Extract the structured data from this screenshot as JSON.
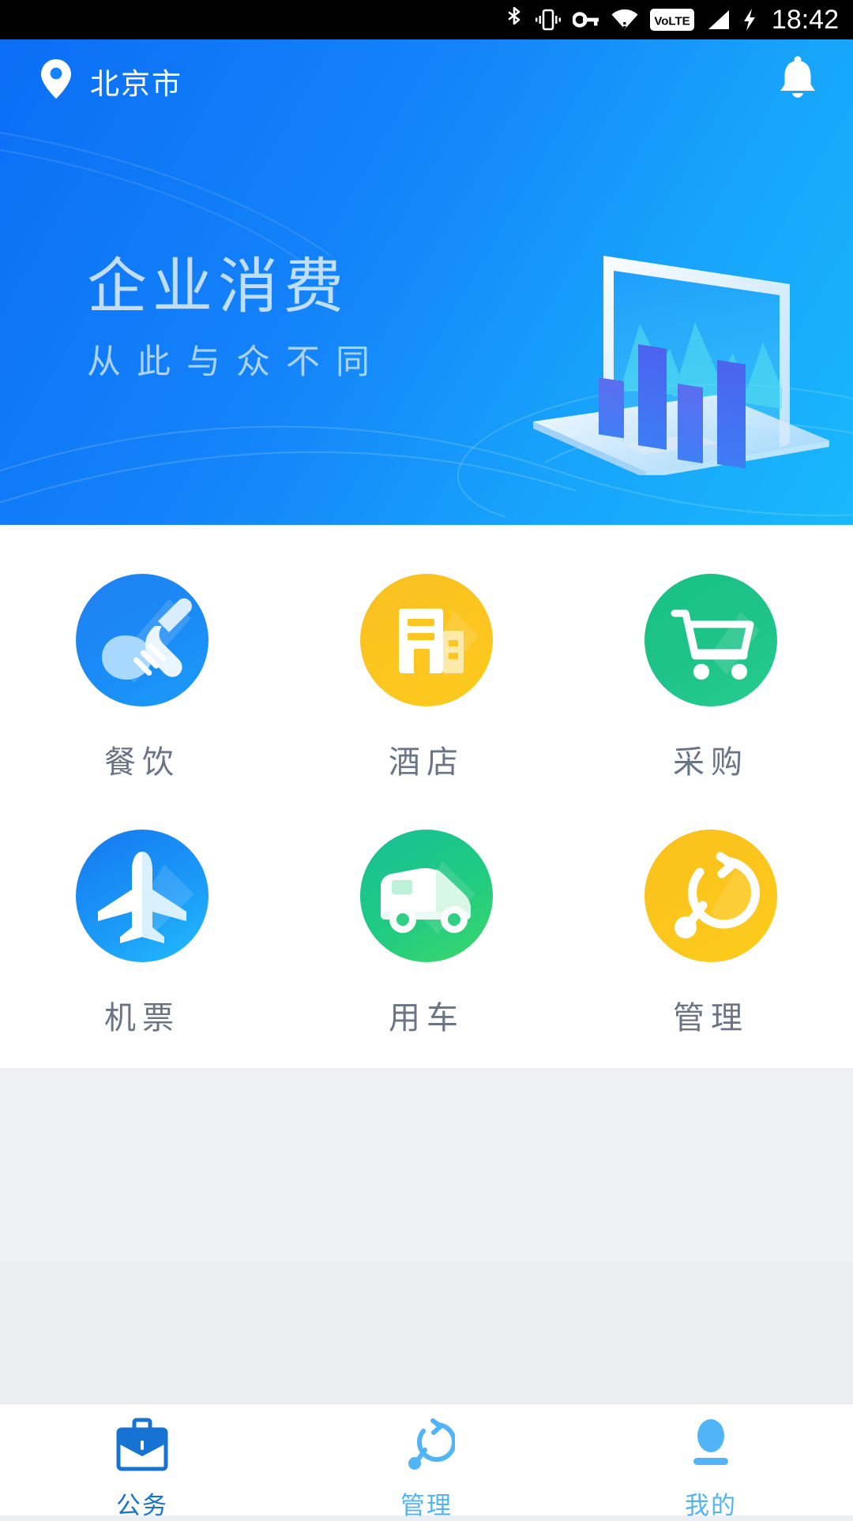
{
  "statusbar": {
    "time": "18:42",
    "icons": [
      "bluetooth-icon",
      "vibrate-icon",
      "vpn-key-icon",
      "wifi-icon",
      "volte-icon",
      "signal-icon",
      "charging-bolt-icon"
    ],
    "volte_label": "VoLTE",
    "background": "#000000"
  },
  "header": {
    "location_icon": "location-pin-icon",
    "location": "北京市",
    "notification_icon": "bell-icon"
  },
  "banner": {
    "title": "企业消费",
    "subtitle": "从此与众不同",
    "illustration": "laptop-bar-chart-illustration",
    "gradient_start": "#0b6ef5",
    "gradient_end": "#19b8fc",
    "title_color": "#cfe6ff",
    "subtitle_color": "#bcdcfb"
  },
  "grid": {
    "rows": [
      [
        {
          "label": "餐饮",
          "icon": "fork-spoon-icon",
          "color": "#1a8cf6"
        },
        {
          "label": "酒店",
          "icon": "building-icon",
          "color": "#fcc51f"
        },
        {
          "label": "采购",
          "icon": "shopping-cart-icon",
          "color": "#1ec389"
        }
      ],
      [
        {
          "label": "机票",
          "icon": "airplane-icon",
          "color": "#1b9bf8"
        },
        {
          "label": "用车",
          "icon": "car-icon",
          "color": "#22cc7f"
        },
        {
          "label": "管理",
          "icon": "management-icon",
          "color": "#fcc61c"
        }
      ]
    ],
    "label_color": "#6a7486"
  },
  "tabbar": {
    "items": [
      {
        "label": "公务",
        "icon": "briefcase-icon",
        "active": true,
        "color": "#1673d4"
      },
      {
        "label": "管理",
        "icon": "management-icon",
        "active": false,
        "color": "#50b4f7"
      },
      {
        "label": "我的",
        "icon": "person-icon",
        "active": false,
        "color": "#50b4f7"
      }
    ]
  },
  "colors": {
    "page_background": "#eef0f3",
    "card_background": "#ffffff",
    "accent": "#1484fa"
  }
}
